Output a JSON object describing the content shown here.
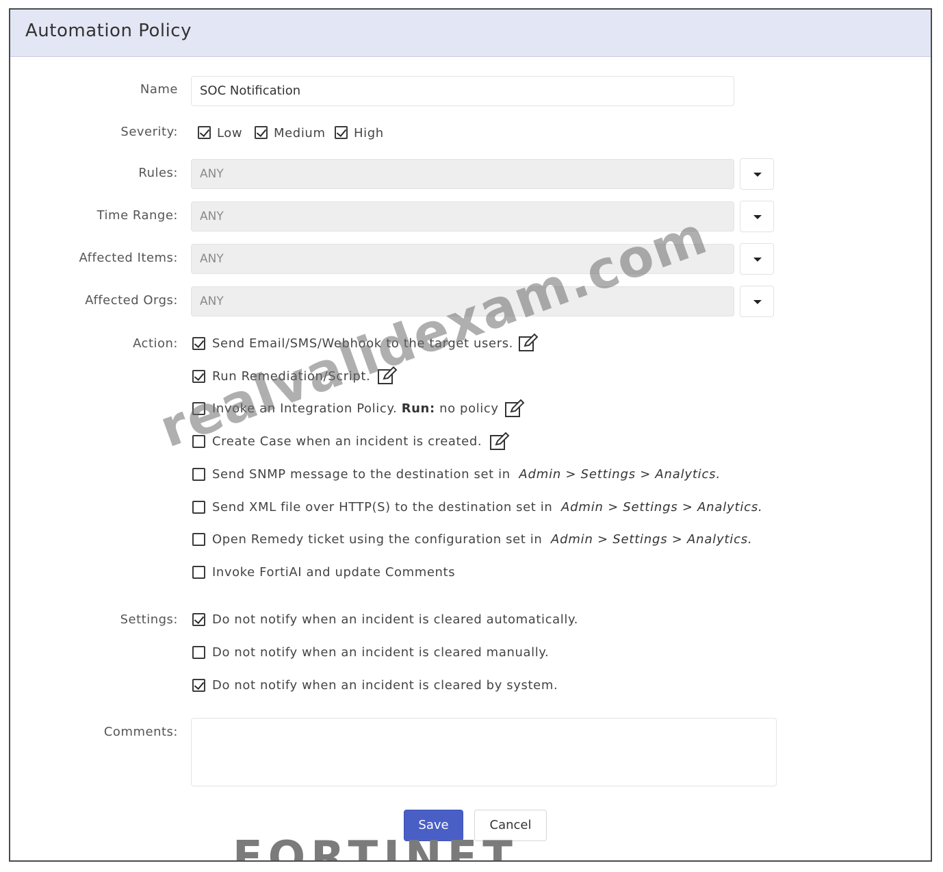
{
  "dialog": {
    "title": "Automation Policy"
  },
  "form": {
    "name_label": "Name",
    "name_value": "SOC Notification",
    "severity_label": "Severity:",
    "severity_options": [
      {
        "label": "Low",
        "checked": true
      },
      {
        "label": "Medium",
        "checked": true
      },
      {
        "label": "High",
        "checked": true
      }
    ],
    "rules_label": "Rules:",
    "rules_value": "ANY",
    "time_range_label": "Time Range:",
    "time_range_value": "ANY",
    "affected_items_label": "Affected Items:",
    "affected_items_value": "ANY",
    "affected_orgs_label": "Affected Orgs:",
    "affected_orgs_value": "ANY",
    "action_label": "Action:",
    "actions": [
      {
        "text": "Send Email/SMS/Webhook to the target users.",
        "checked": true,
        "editable": true
      },
      {
        "text": "Run Remediation/Script.",
        "checked": true,
        "editable": true
      },
      {
        "text": "Invoke an Integration Policy.",
        "run_label": "Run:",
        "run_value": "no policy",
        "checked": false,
        "editable": true
      },
      {
        "text": "Create Case when an incident is created.",
        "checked": false,
        "editable": true
      },
      {
        "text": "Send SNMP message to the destination set in",
        "path": [
          "Admin",
          "Settings",
          "Analytics."
        ],
        "checked": false
      },
      {
        "text": "Send XML file over HTTP(S) to the destination set in",
        "path": [
          "Admin",
          "Settings",
          "Analytics."
        ],
        "checked": false
      },
      {
        "text": "Open Remedy ticket using the configuration set in",
        "path": [
          "Admin",
          "Settings",
          "Analytics."
        ],
        "checked": false
      },
      {
        "text": "Invoke FortiAI and update Comments",
        "checked": false
      }
    ],
    "settings_label": "Settings:",
    "settings": [
      {
        "text": "Do not notify when an incident is cleared automatically.",
        "checked": true
      },
      {
        "text": "Do not notify when an incident is cleared manually.",
        "checked": false
      },
      {
        "text": "Do not notify when an incident is cleared by system.",
        "checked": true
      }
    ],
    "comments_label": "Comments:",
    "comments_value": ""
  },
  "buttons": {
    "save": "Save",
    "cancel": "Cancel"
  },
  "path_separator": ">",
  "overlay": {
    "watermark": "realvalidexam.com",
    "logo": "FORTINET",
    "logo_mark": "®"
  },
  "colors": {
    "title_bar": "#e3e6f4",
    "save_button": "#4a5fc6",
    "disabled_field": "#eeeeee"
  }
}
